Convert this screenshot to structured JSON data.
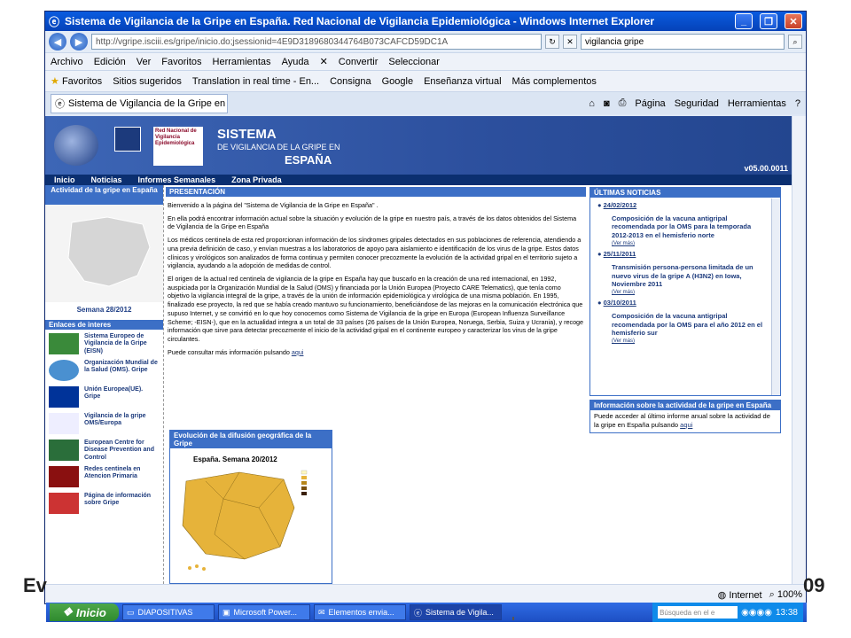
{
  "window": {
    "title": "Sistema de Vigilancia de la Gripe en España. Red Nacional de Vigilancia Epidemiológica - Windows Internet Explorer"
  },
  "address": {
    "url": "http://vgripe.isciii.es/gripe/inicio.do;jsessionid=4E9D3189680344764B073CAFCD59DC1A",
    "search": "vigilancia gripe"
  },
  "menu": {
    "items": [
      "Archivo",
      "Edición",
      "Ver",
      "Favoritos",
      "Herramientas",
      "Ayuda"
    ],
    "convertir": "Convertir",
    "seleccionar": "Seleccionar"
  },
  "favorites": {
    "label": "Favoritos",
    "items": [
      "Sitios sugeridos",
      "Translation in real time - En...",
      "Consigna",
      "Google",
      "Enseñanza virtual",
      "Más complementos"
    ]
  },
  "tab": {
    "label": "Sistema de Vigilancia de la Gripe en Espa...",
    "tools": [
      "Página",
      "Seguridad",
      "Herramientas"
    ]
  },
  "banner": {
    "line1": "SISTEMA",
    "line2": "DE VIGILANCIA DE LA GRIPE EN",
    "line3": "ESPAÑA",
    "version": "v05.00.0011",
    "logo_text": "Red Nacional de Vigilancia Epidemiológica"
  },
  "nav": {
    "items": [
      "Inicio",
      "Noticias",
      "Informes Semanales",
      "Zona Privada"
    ]
  },
  "left": {
    "actividad": "Actividad de la gripe en España",
    "semana": "Semana 28/2012",
    "enlaces": "Enlaces de interes",
    "links": [
      "Sistema Europeo de Vigilancia de la Gripe (EISN)",
      "Organización Mundial de la Salud (OMS). Gripe",
      "Unión Europea(UE). Gripe",
      "Vigilancia de la gripe OMS/Europa",
      "European Centre for Disease Prevention and Control",
      "Redes centinela en Atencion Primaria",
      "Página de información sobre Gripe"
    ]
  },
  "presentacion": {
    "header": "PRESENTACIÓN",
    "p1": "Bienvenido a la página del \"Sistema de Vigilancia de la Gripe en España\" .",
    "p2": "En ella podrá encontrar información actual sobre la situación y evolución de la gripe en nuestro país, a través de los datos obtenidos del Sistema de Vigilancia de la Gripe en España",
    "p3": "Los médicos centinela de esta red proporcionan información de los síndromes gripales detectados en sus poblaciones de referencia, atendiendo a una previa definición de caso, y envían muestras a los laboratorios de apoyo para aislamiento e identificación de los virus de la gripe. Estos datos clínicos y virológicos son analizados de forma continua y permiten conocer precozmente la evolución de la actividad gripal en el territorio sujeto a vigilancia, ayudando a la adopción de medidas de control.",
    "p4": "El origen de la actual red centinela de vigilancia de la gripe en España hay que buscarlo en la creación de una red internacional, en 1992, auspiciada por la Organización Mundial de la Salud (OMS) y financiada por la Unión Europea (Proyecto CARE Telematics), que tenía como objetivo la vigilancia integral de la gripe, a través de la unión de información epidemiológica y virológica de una misma población. En 1995, finalizado ese proyecto, la red que se había creado mantuvo su funcionamiento, beneficiándose de las mejoras en la comunicación electrónica que supuso Internet, y se convirtió en lo que hoy conocemos como Sistema de Vigilancia de la gripe en Europa (European Influenza Surveillance Scheme; -EISN-), que en la actualidad integra a un total de 33 países (26 países de la Unión Europea, Noruega, Serbia, Suiza y Ucrania), y recoge información que sirve para detectar precozmente el inicio de la actividad gripal en el continente europeo y caracterizar los virus de la gripe circulantes.",
    "p5": "Puede consultar más información pulsando",
    "aqui": "aqui"
  },
  "evolucion": {
    "header": "Evolución de la difusión geográfica de la Gripe",
    "title": "España. Semana 20/2012"
  },
  "news": {
    "header": "ÚLTIMAS NOTICIAS",
    "vermas": "(Ver más)",
    "items": [
      {
        "date": "24/02/2012",
        "text": "Composición de la vacuna antigripal recomendada por la OMS para la temporada 2012-2013 en el hemisferio norte"
      },
      {
        "date": "25/11/2011",
        "text": "Transmisión persona-persona limitada de un nuevo virus de la gripe A (H3N2) en Iowa, Noviembre 2011"
      },
      {
        "date": "03/10/2011",
        "text": "Composición de la vacuna antigripal recomendada por la OMS para el año 2012 en el hemisferio sur"
      }
    ]
  },
  "info": {
    "header": "Información sobre la actividad de la gripe en España",
    "text": "Puede acceder al último informe anual sobre la actividad de la gripe en España pulsando",
    "link": "aqui"
  },
  "status": {
    "zone": "Internet",
    "zoom": "100%"
  },
  "overlay": {
    "left": "Ev",
    "right": "09"
  },
  "taskbar": {
    "start": "Inicio",
    "tasks": [
      "DIAPOSITIVAS",
      "Microsoft Power...",
      "Elementos envia...",
      "Sistema de Vigila..."
    ],
    "search": "Búsqueda en el e",
    "clock": "13:38"
  }
}
